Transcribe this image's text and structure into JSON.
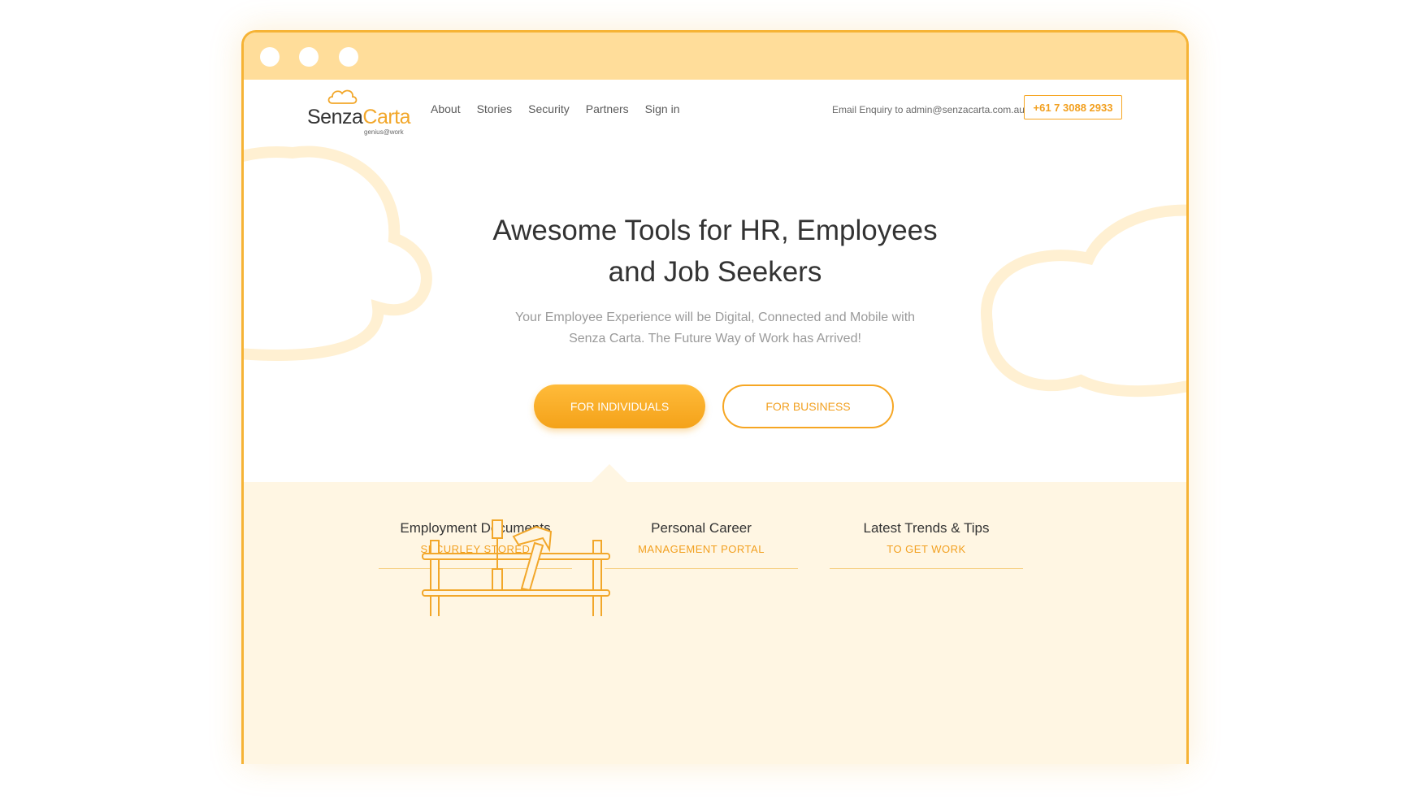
{
  "brand": {
    "name_part1": "Senza",
    "name_part2": "Carta",
    "tagline": "genius@work",
    "accent_color": "#f6a623",
    "titlebar_color": "#ffdd9a"
  },
  "nav": {
    "items": [
      {
        "label": "About"
      },
      {
        "label": "Stories"
      },
      {
        "label": "Security"
      },
      {
        "label": "Partners"
      },
      {
        "label": "Sign in"
      }
    ],
    "enquiry": "Email Enquiry to admin@senzacarta.com.au",
    "phone": "+61 7 3088 2933"
  },
  "hero": {
    "title_line1": "Awesome Tools for HR, Employees",
    "title_line2": "and Job Seekers",
    "subtitle_line1": "Your Employee Experience will be Digital, Connected and Mobile with",
    "subtitle_line2": "Senza Carta. The Future Way of Work has Arrived!",
    "btn_individuals": "FOR INDIVIDUALS",
    "btn_business": "FOR BUSINESS"
  },
  "features": [
    {
      "title": "Employment Documents",
      "subtitle": "SECURLEY STORED"
    },
    {
      "title": "Personal Career",
      "subtitle": "MANAGEMENT PORTAL"
    },
    {
      "title": "Latest Trends & Tips",
      "subtitle": "TO GET WORK"
    }
  ],
  "icons": [
    "window-dot",
    "cloud-logo-icon",
    "cloud-background",
    "toolbox-illustration"
  ]
}
